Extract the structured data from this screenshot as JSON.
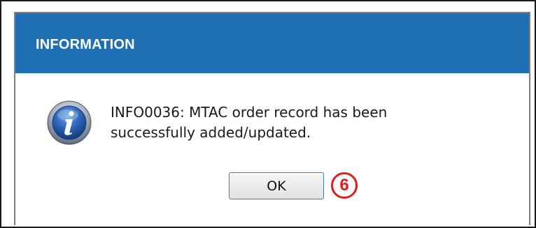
{
  "dialog": {
    "title": "INFORMATION",
    "icon": "info-icon",
    "message_line1": "INFO0036: MTAC order record has been",
    "message_line2": "successfully added/updated.",
    "ok_label": "OK"
  },
  "annotation": {
    "step_number": "6",
    "color": "#e01d1d"
  },
  "colors": {
    "title_bar": "#1f6fb5",
    "button_border": "#4a7bbf"
  }
}
